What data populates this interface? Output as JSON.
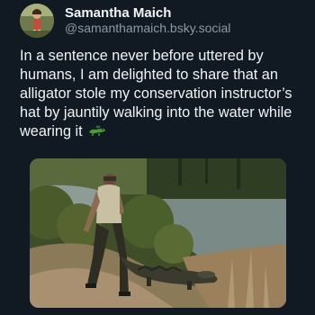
{
  "post": {
    "author": {
      "display_name": "Samantha Maich",
      "handle": "@samanthamaich.bsky.social"
    },
    "text": "In a sentence never before uttered by humans, I am delighted to share that an alligator stole my conservation instructor’s hat by jauntily walking into the water while wearing it",
    "emoji": "alligator-emoji"
  },
  "colors": {
    "background": "#111a22",
    "text_primary": "#f1f3f5",
    "text_secondary": "#8b98a6",
    "emoji_green": "#4d9a3a"
  }
}
